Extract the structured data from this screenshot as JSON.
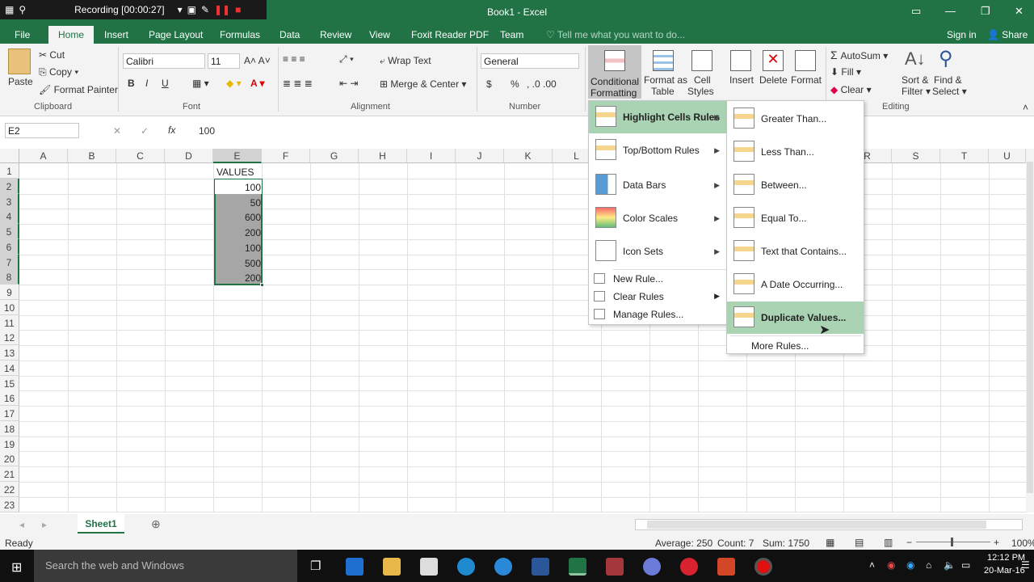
{
  "recorder": {
    "label": "Recording [00:00:27]"
  },
  "window": {
    "title": "Book1 - Excel"
  },
  "tabs": [
    "File",
    "Home",
    "Insert",
    "Page Layout",
    "Formulas",
    "Data",
    "Review",
    "View",
    "Foxit Reader PDF",
    "Team"
  ],
  "tell_me": "Tell me what you want to do...",
  "account": {
    "signin": "Sign in",
    "share": "Share"
  },
  "clipboard": {
    "paste": "Paste",
    "cut": "Cut",
    "copy": "Copy",
    "format_painter": "Format Painter",
    "group": "Clipboard"
  },
  "font": {
    "name": "Calibri",
    "size": "11",
    "group": "Font",
    "bold": "B",
    "italic": "I",
    "underline": "U"
  },
  "alignment": {
    "wrap": "Wrap Text",
    "merge": "Merge & Center",
    "group": "Alignment"
  },
  "number": {
    "format": "General",
    "currency": "$",
    "percent": "%",
    "group": "Number"
  },
  "styles": {
    "cond1": "Conditional",
    "cond2": "Formatting",
    "table1": "Format as",
    "table2": "Table",
    "cell1": "Cell",
    "cell2": "Styles"
  },
  "cells": {
    "insert": "Insert",
    "delete": "Delete",
    "format": "Format"
  },
  "editing": {
    "autosum": "AutoSum",
    "fill": "Fill",
    "clear": "Clear",
    "sort1": "Sort &",
    "sort2": "Filter",
    "find1": "Find &",
    "find2": "Select",
    "group": "Editing"
  },
  "formula_bar": {
    "name_box": "E2",
    "fx": "fx",
    "value": "100"
  },
  "columns": [
    "A",
    "B",
    "C",
    "D",
    "E",
    "F",
    "G",
    "H",
    "I",
    "J",
    "K",
    "L",
    "M",
    "N",
    "O",
    "P",
    "Q",
    "R",
    "S",
    "T",
    "U"
  ],
  "rows": [
    "1",
    "2",
    "3",
    "4",
    "5",
    "6",
    "7",
    "8",
    "9",
    "10",
    "11",
    "12",
    "13",
    "14",
    "15",
    "16",
    "17",
    "18",
    "19",
    "20",
    "21",
    "22",
    "23"
  ],
  "cells_data": {
    "e1": "VALUES",
    "e_values": [
      "100",
      "50",
      "600",
      "200",
      "100",
      "500",
      "200"
    ]
  },
  "cf_menu": {
    "items": [
      "Highlight Cells Rules",
      "Top/Bottom Rules",
      "Data Bars",
      "Color Scales",
      "Icon Sets"
    ],
    "small": [
      "New Rule...",
      "Clear Rules",
      "Manage Rules..."
    ]
  },
  "submenu": {
    "items": [
      "Greater Than...",
      "Less Than...",
      "Between...",
      "Equal To...",
      "Text that Contains...",
      "A Date Occurring...",
      "Duplicate Values..."
    ],
    "more": "More Rules..."
  },
  "sheet": {
    "name": "Sheet1"
  },
  "status": {
    "ready": "Ready",
    "average": "Average: 250",
    "count": "Count: 7",
    "sum": "Sum: 1750",
    "zoom": "100%"
  },
  "taskbar": {
    "search": "Search the web and Windows",
    "time": "12:12 PM",
    "date": "20-Mar-16"
  },
  "colors": {
    "excel_green": "#217346",
    "highlight": "#a9d3b3",
    "selected_cell": "#a6a6a6"
  }
}
